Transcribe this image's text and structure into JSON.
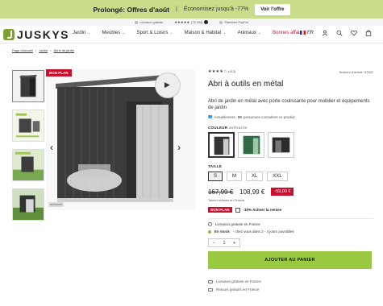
{
  "promo": {
    "title": "Prolongé: Offres d'août",
    "separator": "|",
    "subtitle": "Économisez jusqu'à -77%",
    "button": "Voir l'offre"
  },
  "trust": {
    "shipping": "Livraison gratuite",
    "stars": "★★★★★",
    "reviews": "(74.334)",
    "paypal": "Paiement PayPal"
  },
  "brand": {
    "logo_text": "JUSKYS"
  },
  "nav": {
    "items": [
      "Jardin",
      "Meubles",
      "Sport & Loisirs",
      "Maison & Habitat",
      "Animaux",
      "Bonnes affaires"
    ],
    "lang": "FR"
  },
  "breadcrumb": [
    "Page d'accueil",
    "Jardin",
    "Abris de jardin"
  ],
  "product": {
    "badge": "BON PLAN",
    "stars": "★★★★☆",
    "rating_count": "(413)",
    "item_number": "Numéro d'article: 37837",
    "title": "Abri à outils en métal",
    "description": "Abri de jardin en métal avec porte coulissante pour mobilier et équipements de jardin",
    "viewers_prefix": "Actuellement,",
    "viewers_count": "90",
    "viewers_suffix": "personnes consultent ce produit",
    "color_label": "COULEUR",
    "color_value": "anthracite",
    "size_label": "TAILLE",
    "sizes": [
      "S",
      "M",
      "XL",
      "XXL"
    ],
    "old_price": "167,99 €",
    "new_price": "108,99 €",
    "discount": "-59,00 €",
    "tax_note": "Taxes incluses en France",
    "bonplan_badge": "BON PLAN",
    "bonplan_text": "-10% Activer la remise",
    "shipping": "Livraison gratuite en France",
    "stock_label": "En stock",
    "stock_detail": "- chez vous dans 2 - 4 jours ouvrables",
    "quantity": "1",
    "qty_minus": "−",
    "qty_plus": "+",
    "cta": "AJOUTER AU PANIER",
    "footer_shipping": "Livraison gratuite en France",
    "footer_returns": "Retours gratuits en France",
    "image_tag": "anthracite"
  },
  "colors": {
    "accent": "#99c941",
    "promo_bg": "#c9dc8a",
    "sale_red": "#c8102e"
  }
}
